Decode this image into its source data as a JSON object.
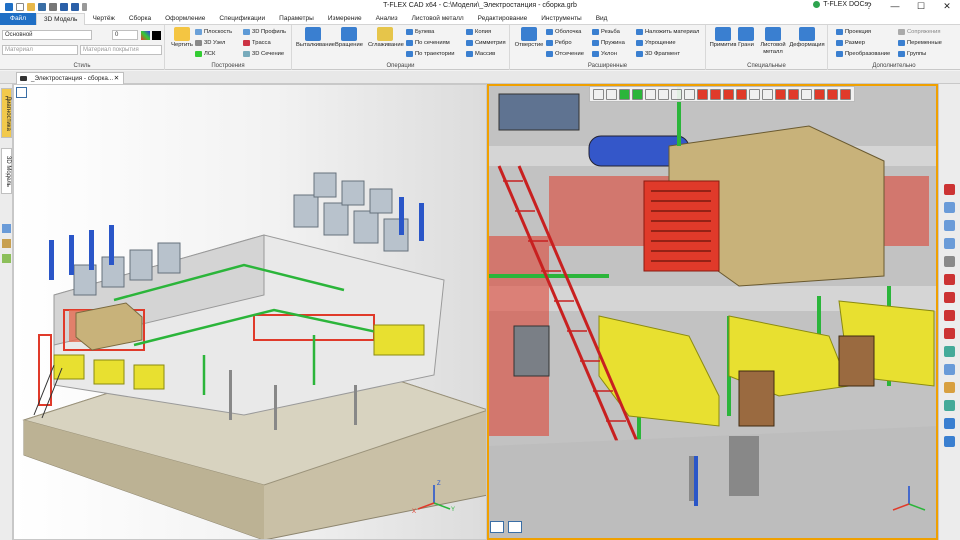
{
  "app": {
    "title": "T-FLEX CAD x64 - C:\\Модели\\_Электростанция - сборка.grb",
    "docs_label": "T-FLEX DOCs"
  },
  "window_controls": {
    "help": "?",
    "minimize": "—",
    "maximize": "☐",
    "close": "✕"
  },
  "tabs": [
    "Файл",
    "3D Модель",
    "Чертёж",
    "Сборка",
    "Оформление",
    "Спецификации",
    "Параметры",
    "Измерение",
    "Анализ",
    "Листовой металл",
    "Редактирование",
    "Инструменты",
    "Вид"
  ],
  "ribbon": {
    "style": {
      "label": "Стиль",
      "layer_value": "Основной",
      "number_value": "0",
      "material_placeholder": "Материал",
      "coating_placeholder": "Материал покрытия"
    },
    "construct": {
      "label": "Построения",
      "draw": "Чертить",
      "plane": "Плоскость",
      "node3d": "3D Узел",
      "lsk": "ЛСК",
      "profile3d": "3D Профиль",
      "path": "Трасса",
      "section3d": "3D Сечение"
    },
    "operations": {
      "label": "Операции",
      "extrude": "Выталкивание",
      "rotate": "Вращение",
      "smooth": "Сглаживание",
      "boolean": "Булева",
      "by_sections": "По сечениям",
      "by_path": "По траектории",
      "copy": "Копия",
      "symmetry": "Симметрия",
      "array": "Массив"
    },
    "extended": {
      "label": "Расширенные",
      "hole": "Отверстие",
      "shell": "Оболочка",
      "rib": "Ребро",
      "cut": "Отсечение",
      "thread": "Резьба",
      "spring": "Пружина",
      "slope": "Уклон",
      "apply_material": "Наложить материал",
      "simplify": "Упрощение",
      "fragment3d": "3D Фрагмент"
    },
    "special": {
      "label": "Специальные",
      "primitives": "Примитив",
      "faces": "Грани",
      "sheet_metal": "Листовой металл",
      "deformation": "Деформация"
    },
    "extra": {
      "label": "Дополнительно",
      "projection": "Проекция",
      "size": "Размер",
      "transform": "Преобразование",
      "constraints": "Сопряжения",
      "variables": "Переменные",
      "groups": "Группы"
    }
  },
  "document": {
    "tab_title": "_Электростанция - сборка...",
    "close": "✕"
  },
  "left_panel": {
    "diagnostics": "Диагностика",
    "model3d": "3D Модель"
  },
  "axes": {
    "x": "X",
    "y": "Y",
    "z": "Z"
  },
  "colors": {
    "accent": "#1f6fc5",
    "active_border": "#f0a000",
    "structure_red": "#e03a2a",
    "pipe_green": "#2bb53a",
    "engine_yellow": "#e8e030",
    "tank_tan": "#c8b27a"
  }
}
